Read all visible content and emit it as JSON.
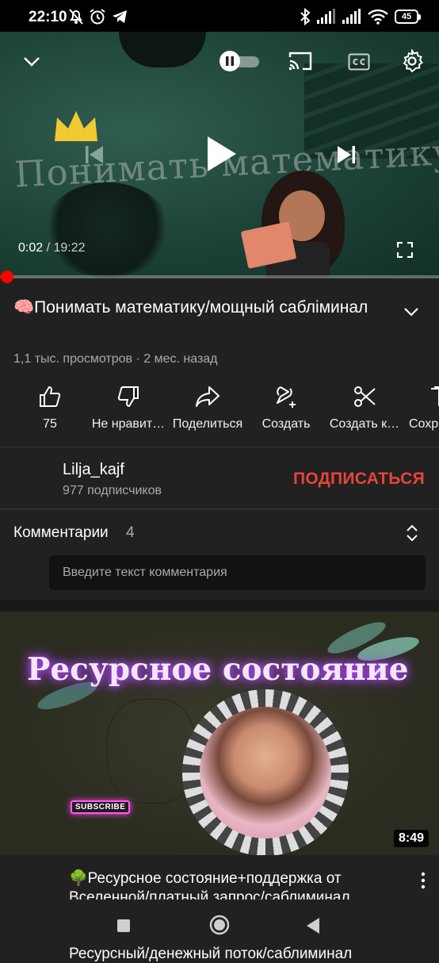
{
  "status_bar": {
    "time": "22:10",
    "battery": "45"
  },
  "player": {
    "current_time": "0:02",
    "separator": " / ",
    "duration": "19:22",
    "progress_fraction": 0.002,
    "thumbnail_text": "Понимать математику",
    "icons": [
      "chevron-down-icon",
      "pause-icon",
      "cast-icon",
      "cc-icon",
      "gear-icon",
      "skip-previous-icon",
      "play-icon",
      "skip-next-icon",
      "fullscreen-icon"
    ]
  },
  "video": {
    "title": "🧠Понимать математику/мощный сабліминал",
    "meta": "1,1 тыс. просмотров · 2 мес. назад"
  },
  "actions": [
    {
      "label": "75",
      "icon": "thumbs-up-icon"
    },
    {
      "label": "Не нравит…",
      "icon": "thumbs-down-icon"
    },
    {
      "label": "Поделиться",
      "icon": "share-icon"
    },
    {
      "label": "Создать",
      "icon": "create-icon"
    },
    {
      "label": "Создать к…",
      "icon": "scissors-icon"
    },
    {
      "label": "Сохр",
      "icon": "save-icon"
    }
  ],
  "channel": {
    "name": "Lilja_kajf",
    "subscribers": "977 подписчиков",
    "subscribe_label": "ПОДПИСАТЬСЯ"
  },
  "comments": {
    "title": "Комментарии",
    "count": "4",
    "placeholder": "Введите текст комментария"
  },
  "recommended": {
    "thumbnail_text": "Ресурсное состояние",
    "subscribe_badge": "SUBSCRIBE",
    "duration": "8:49",
    "title_line1": "🌳Ресурсное состояние+поддержка от",
    "title_line2": "Вселенной/платный запрос/саблиминал",
    "next_title_partial": "Ресурсный/денежный поток/саблиминал"
  },
  "colors": {
    "background": "#212121",
    "accent_red": "#ff0000",
    "subscribe_red": "#e8443a"
  }
}
